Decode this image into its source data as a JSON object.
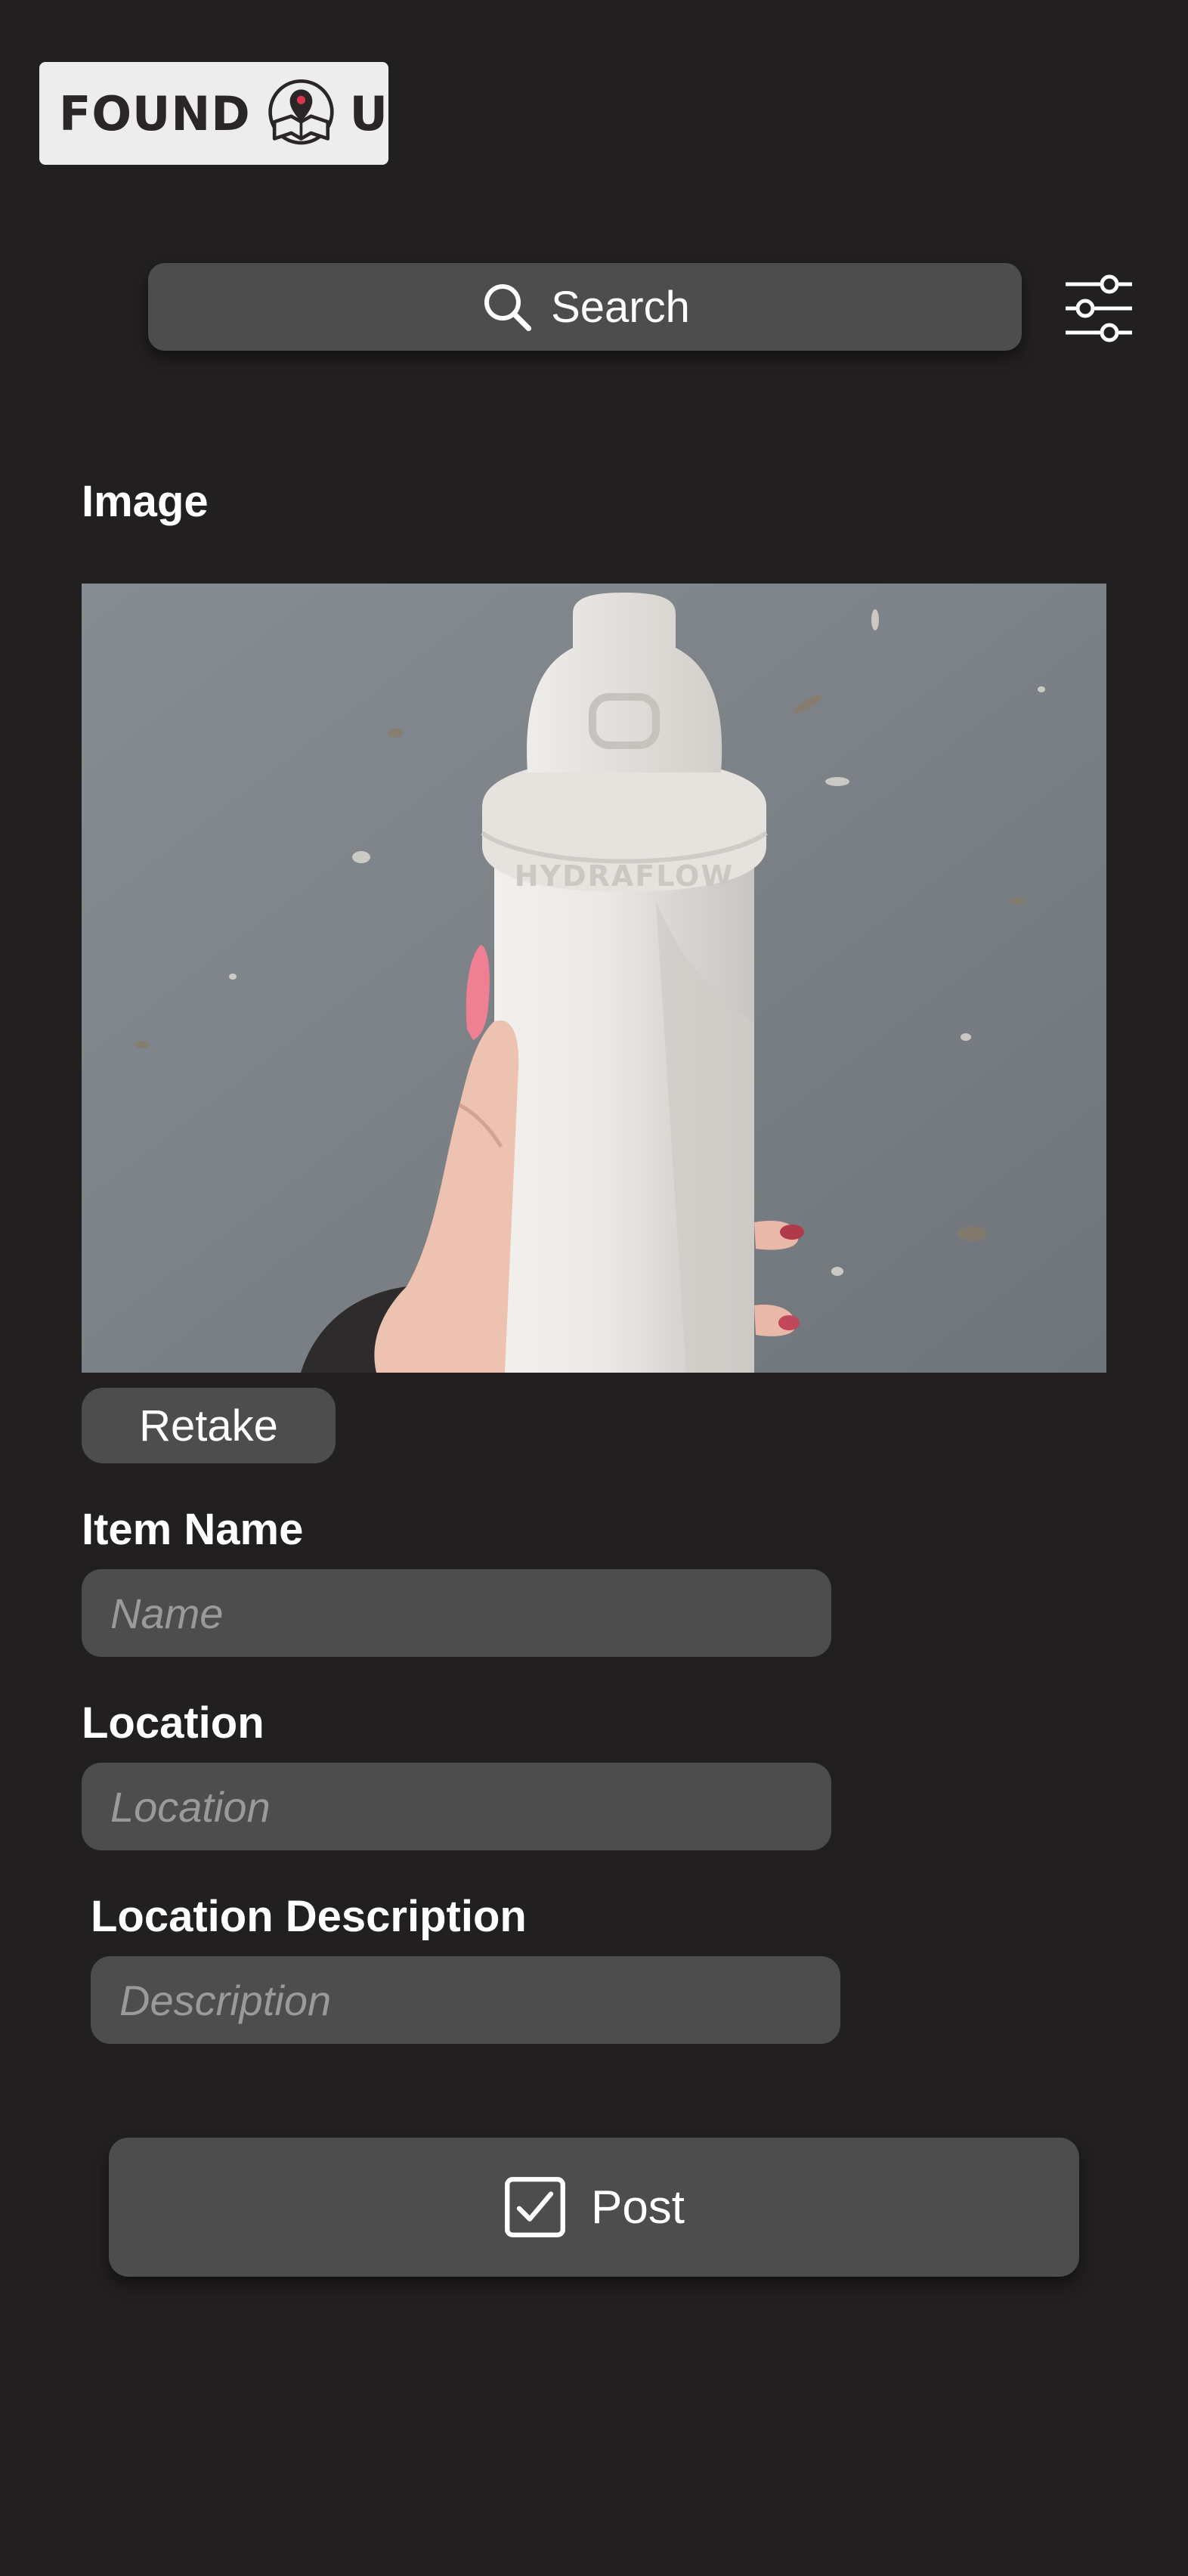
{
  "header": {
    "logo_left": "FOUND",
    "logo_right": "U",
    "logo_icon": "map-pin-book-icon"
  },
  "search": {
    "label": "Search",
    "icon": "search-icon",
    "filter_icon": "sliders-icon"
  },
  "form": {
    "image_label": "Image",
    "photo_alt": "White water bottle held in hand over asphalt",
    "retake_label": "Retake",
    "item_name_label": "Item Name",
    "item_name_placeholder": "Name",
    "location_label": "Location",
    "location_placeholder": "Location",
    "location_description_label": "Location Description",
    "location_description_placeholder": "Description",
    "post_label": "Post",
    "post_icon": "checkbox-icon"
  },
  "colors": {
    "background": "#221f20",
    "surface": "#4d4d4d",
    "logo_background": "#eeeded",
    "text": "#ffffff",
    "placeholder": "#9a9a9a"
  }
}
